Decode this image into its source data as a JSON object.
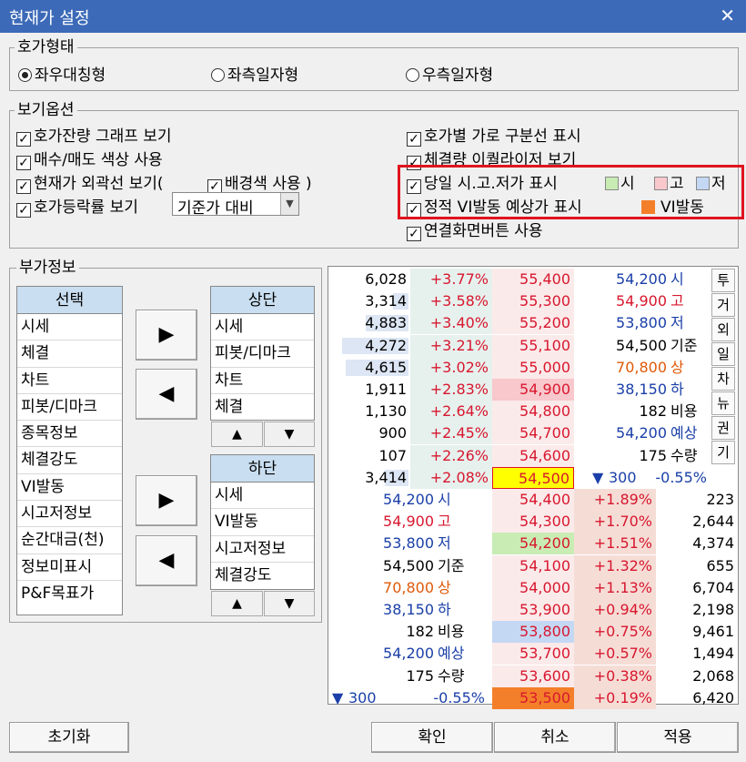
{
  "window": {
    "title": "현재가 설정",
    "close": "✕"
  },
  "quote_type": {
    "label": "호가형태",
    "options": [
      "좌우대칭형",
      "좌측일자형",
      "우측일자형"
    ],
    "selected": "좌우대칭형"
  },
  "view_options": {
    "label": "보기옵션",
    "left": [
      {
        "label": "호가잔량 그래프 보기",
        "checked": true
      },
      {
        "label": "매수/매도 색상 사용",
        "checked": true
      },
      {
        "label": "현재가 외곽선 보기(",
        "checked": true
      },
      {
        "label": "호가등락률 보기",
        "checked": true
      }
    ],
    "bg_color": {
      "label": "배경색 사용 )",
      "checked": true
    },
    "rate_select": "기준가 대비",
    "right": [
      {
        "label": "호가별 가로 구분선 표시",
        "checked": true
      },
      {
        "label": "체결량 이퀄라이저 보기",
        "checked": true
      },
      {
        "label": "당일 시.고.저가 표시",
        "checked": true
      },
      {
        "label": "정적 VI발동 예상가 표시",
        "checked": true
      },
      {
        "label": "연결화면버튼 사용",
        "checked": true
      }
    ],
    "legend_high_low": [
      {
        "label": "시",
        "color": "#c8ecb4"
      },
      {
        "label": "고",
        "color": "#f8c8cc"
      },
      {
        "label": "저",
        "color": "#c4d8f4"
      }
    ],
    "legend_vi": {
      "label": "VI발동",
      "color": "#f47f2a"
    }
  },
  "extra_info": {
    "label": "부가정보",
    "select_header": "선택",
    "select_items": [
      "시세",
      "체결",
      "차트",
      "피봇/디마크",
      "종목정보",
      "체결강도",
      "VI발동",
      "시고저정보",
      "순간대금(천)",
      "정보미표시",
      "P&F목표가"
    ],
    "top_header": "상단",
    "top_items": [
      "시세",
      "피봇/디마크",
      "차트",
      "체결"
    ],
    "bottom_header": "하단",
    "bottom_items": [
      "시세",
      "VI발동",
      "시고저정보",
      "체결강도"
    ],
    "arrow_right": "▶",
    "arrow_left": "◀",
    "arrow_up": "▲",
    "arrow_down": "▼"
  },
  "preview": {
    "ask_rows": [
      {
        "qty": "6,028",
        "rate": "+3.77%",
        "price": "55,400",
        "bar": 0.0
      },
      {
        "qty": "3,314",
        "rate": "+3.58%",
        "price": "55,300",
        "bar": 0.2
      },
      {
        "qty": "4,883",
        "rate": "+3.40%",
        "price": "55,200",
        "bar": 0.55
      },
      {
        "qty": "4,272",
        "rate": "+3.21%",
        "price": "55,100",
        "bar": 0.85
      },
      {
        "qty": "4,615",
        "rate": "+3.02%",
        "price": "55,000",
        "bar": 0.8
      },
      {
        "qty": "1,911",
        "rate": "+2.83%",
        "price": "54,900",
        "bar": 0.0
      },
      {
        "qty": "1,130",
        "rate": "+2.64%",
        "price": "54,800",
        "bar": 0.0
      },
      {
        "qty": "900",
        "rate": "+2.45%",
        "price": "54,700",
        "bar": 0.0
      },
      {
        "qty": "107",
        "rate": "+2.26%",
        "price": "54,600",
        "bar": 0.0
      },
      {
        "qty": "3,414",
        "rate": "+2.08%",
        "price": "54,500",
        "bar": 0.3
      }
    ],
    "bid_rows": [
      {
        "price": "54,400",
        "rate": "+1.89%",
        "qty": "223"
      },
      {
        "price": "54,300",
        "rate": "+1.70%",
        "qty": "2,644"
      },
      {
        "price": "54,200",
        "rate": "+1.51%",
        "qty": "4,374"
      },
      {
        "price": "54,100",
        "rate": "+1.32%",
        "qty": "655"
      },
      {
        "price": "54,000",
        "rate": "+1.13%",
        "qty": "6,704"
      },
      {
        "price": "53,900",
        "rate": "+0.94%",
        "qty": "2,198"
      },
      {
        "price": "53,800",
        "rate": "+0.75%",
        "qty": "9,461"
      },
      {
        "price": "53,700",
        "rate": "+0.57%",
        "qty": "1,494"
      },
      {
        "price": "53,600",
        "rate": "+0.38%",
        "qty": "2,068"
      },
      {
        "price": "53,500",
        "rate": "+0.19%",
        "qty": "6,420"
      }
    ],
    "info_right": [
      {
        "value": "54,200",
        "label": "시"
      },
      {
        "value": "54,900",
        "label": "고"
      },
      {
        "value": "53,800",
        "label": "저"
      },
      {
        "value": "54,500",
        "label": "기준"
      },
      {
        "value": "70,800",
        "label": "상"
      },
      {
        "value": "38,150",
        "label": "하"
      },
      {
        "value": "182",
        "label": "비용"
      },
      {
        "value": "54,200",
        "label": "예상"
      },
      {
        "value": "175",
        "label": "수량"
      }
    ],
    "change_right": {
      "arrow": "▼",
      "diff": "300",
      "rate": "-0.55%"
    },
    "info_left": [
      {
        "value": "54,200",
        "label": "시"
      },
      {
        "value": "54,900",
        "label": "고"
      },
      {
        "value": "53,800",
        "label": "저"
      },
      {
        "value": "54,500",
        "label": "기준"
      },
      {
        "value": "70,800",
        "label": "상"
      },
      {
        "value": "38,150",
        "label": "하"
      },
      {
        "value": "182",
        "label": "비용"
      },
      {
        "value": "54,200",
        "label": "예상"
      },
      {
        "value": "175",
        "label": "수량"
      }
    ],
    "change_left": {
      "arrow": "▼",
      "diff": "300",
      "rate": "-0.55%"
    },
    "nav_buttons": [
      "투",
      "거",
      "외",
      "일",
      "차",
      "뉴",
      "권",
      "기"
    ]
  },
  "buttons": {
    "reset": "초기화",
    "ok": "확인",
    "cancel": "취소",
    "apply": "적용"
  }
}
